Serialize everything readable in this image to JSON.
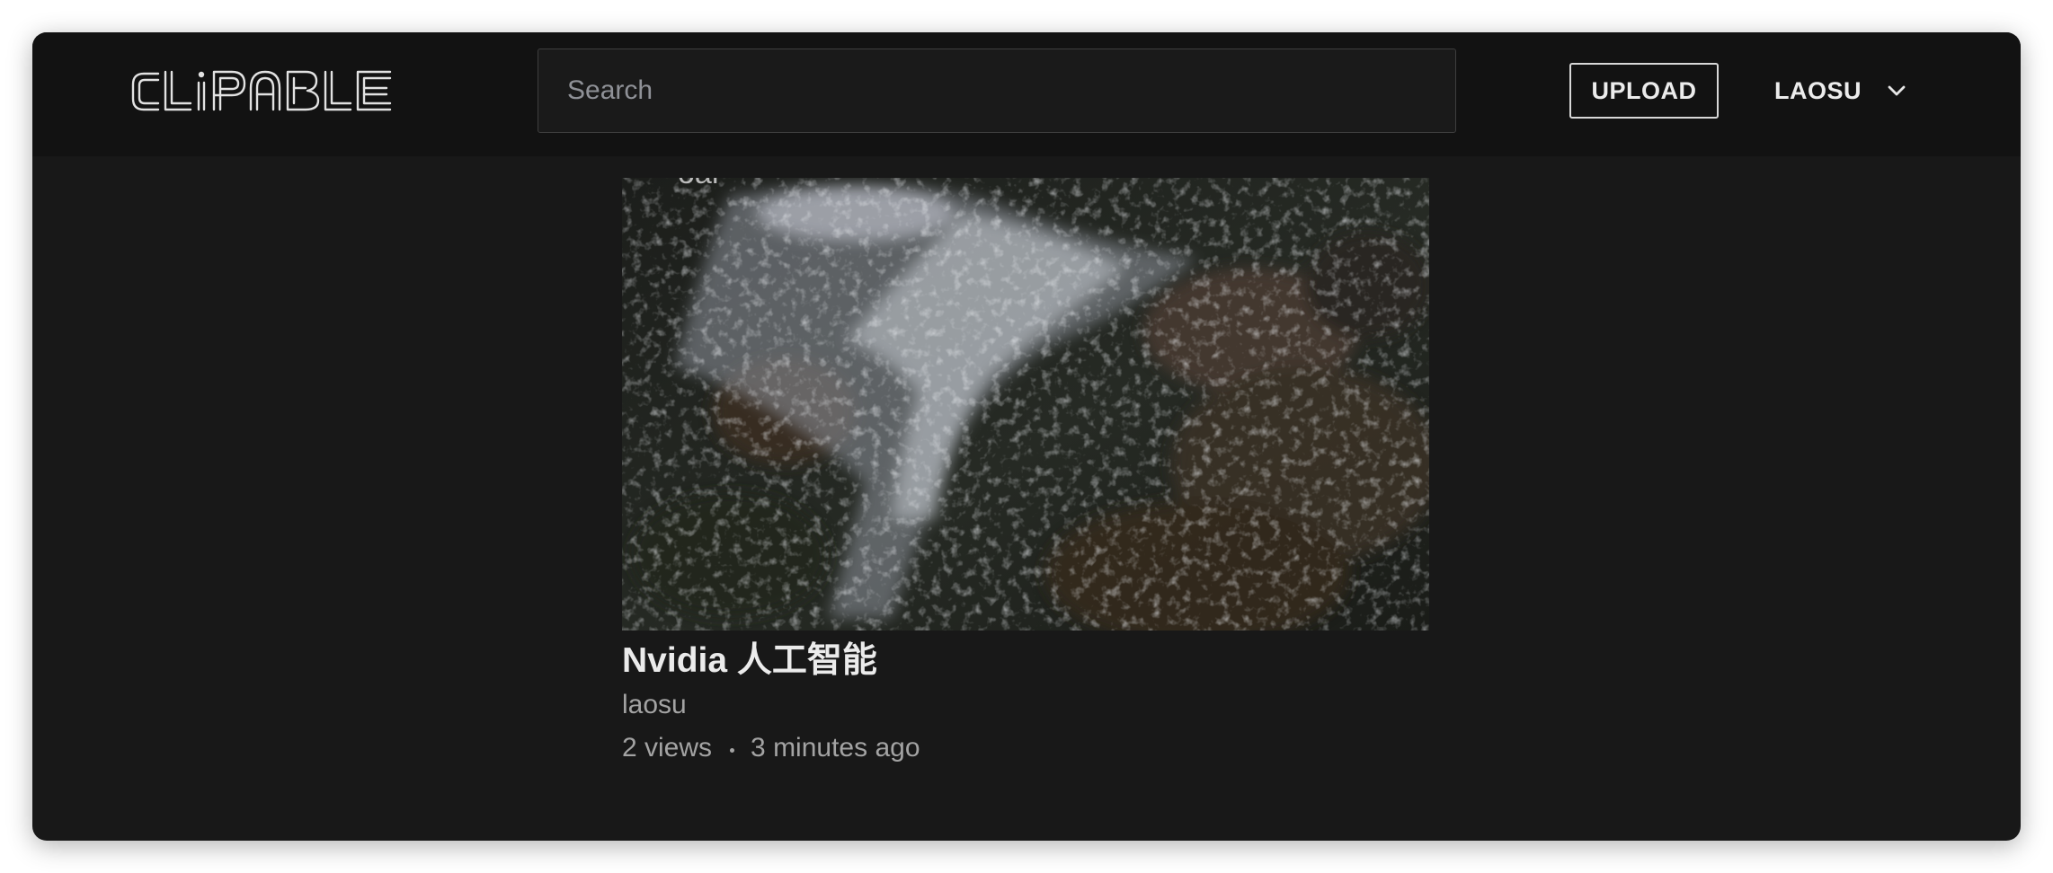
{
  "app": {
    "logo_text": "CLIPABLE"
  },
  "header": {
    "search": {
      "placeholder": "Search",
      "value": ""
    },
    "upload_label": "UPLOAD",
    "user_name": "LAOSU",
    "user_menu_icon": "chevron-down-icon"
  },
  "video": {
    "thumbnail": "water-rapids-thumbnail",
    "title": "Nvidia 人工智能",
    "channel": "laosu",
    "views": "2 views",
    "age": "3 minutes ago"
  },
  "colors": {
    "background": "#181818",
    "topbar": "#121212",
    "text_primary": "#ebebeb",
    "text_secondary": "#a3a3a3",
    "border": "#3e3e3e"
  }
}
